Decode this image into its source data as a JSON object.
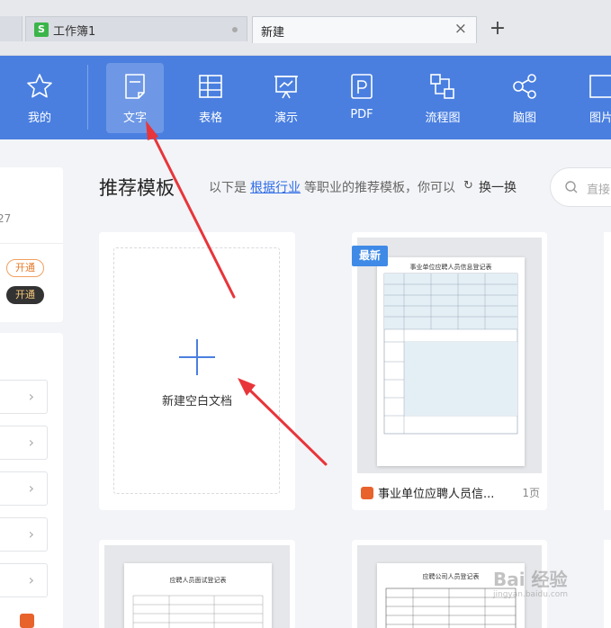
{
  "tabs": [
    {
      "label": "工作簿1",
      "badge": "S"
    },
    {
      "label": "新建",
      "close": "×"
    }
  ],
  "new_tab": "+",
  "toolbar": [
    {
      "label": "我的",
      "icon": "star-icon"
    },
    {
      "label": "文字",
      "icon": "document-icon"
    },
    {
      "label": "表格",
      "icon": "table-icon"
    },
    {
      "label": "演示",
      "icon": "presentation-icon"
    },
    {
      "label": "PDF",
      "icon": "pdf-icon"
    },
    {
      "label": "流程图",
      "icon": "flowchart-icon"
    },
    {
      "label": "脑图",
      "icon": "mindmap-icon"
    },
    {
      "label": "图片",
      "icon": "image-icon"
    }
  ],
  "left": {
    "number": "27",
    "btn1": "开通",
    "btn2": "开通",
    "chevron": "›"
  },
  "section": {
    "title": "推荐模板",
    "desc_prefix": "以下是",
    "link": "根据行业",
    "desc_suffix": "等职业的推荐模板，你可以",
    "swap_icon": "↻",
    "swap": "换一换"
  },
  "search": {
    "placeholder": "直接"
  },
  "new_card": {
    "label": "新建空白文档"
  },
  "template": {
    "tag": "最新",
    "name": "事业单位应聘人员信...",
    "pages": "1页",
    "doc_title": "事业单位应聘人员信息登记表"
  },
  "bottom_cards": [
    {
      "doc_title": "应聘人员面试登记表"
    },
    {
      "doc_title": "应聘公司人员登记表"
    }
  ],
  "watermark": {
    "text": "Bai 经验",
    "sub": "jingyan.baidu.com"
  },
  "colors": {
    "accent": "#4a7fe0",
    "new_tag": "#3e8ae6",
    "arrow": "#e8353a"
  }
}
